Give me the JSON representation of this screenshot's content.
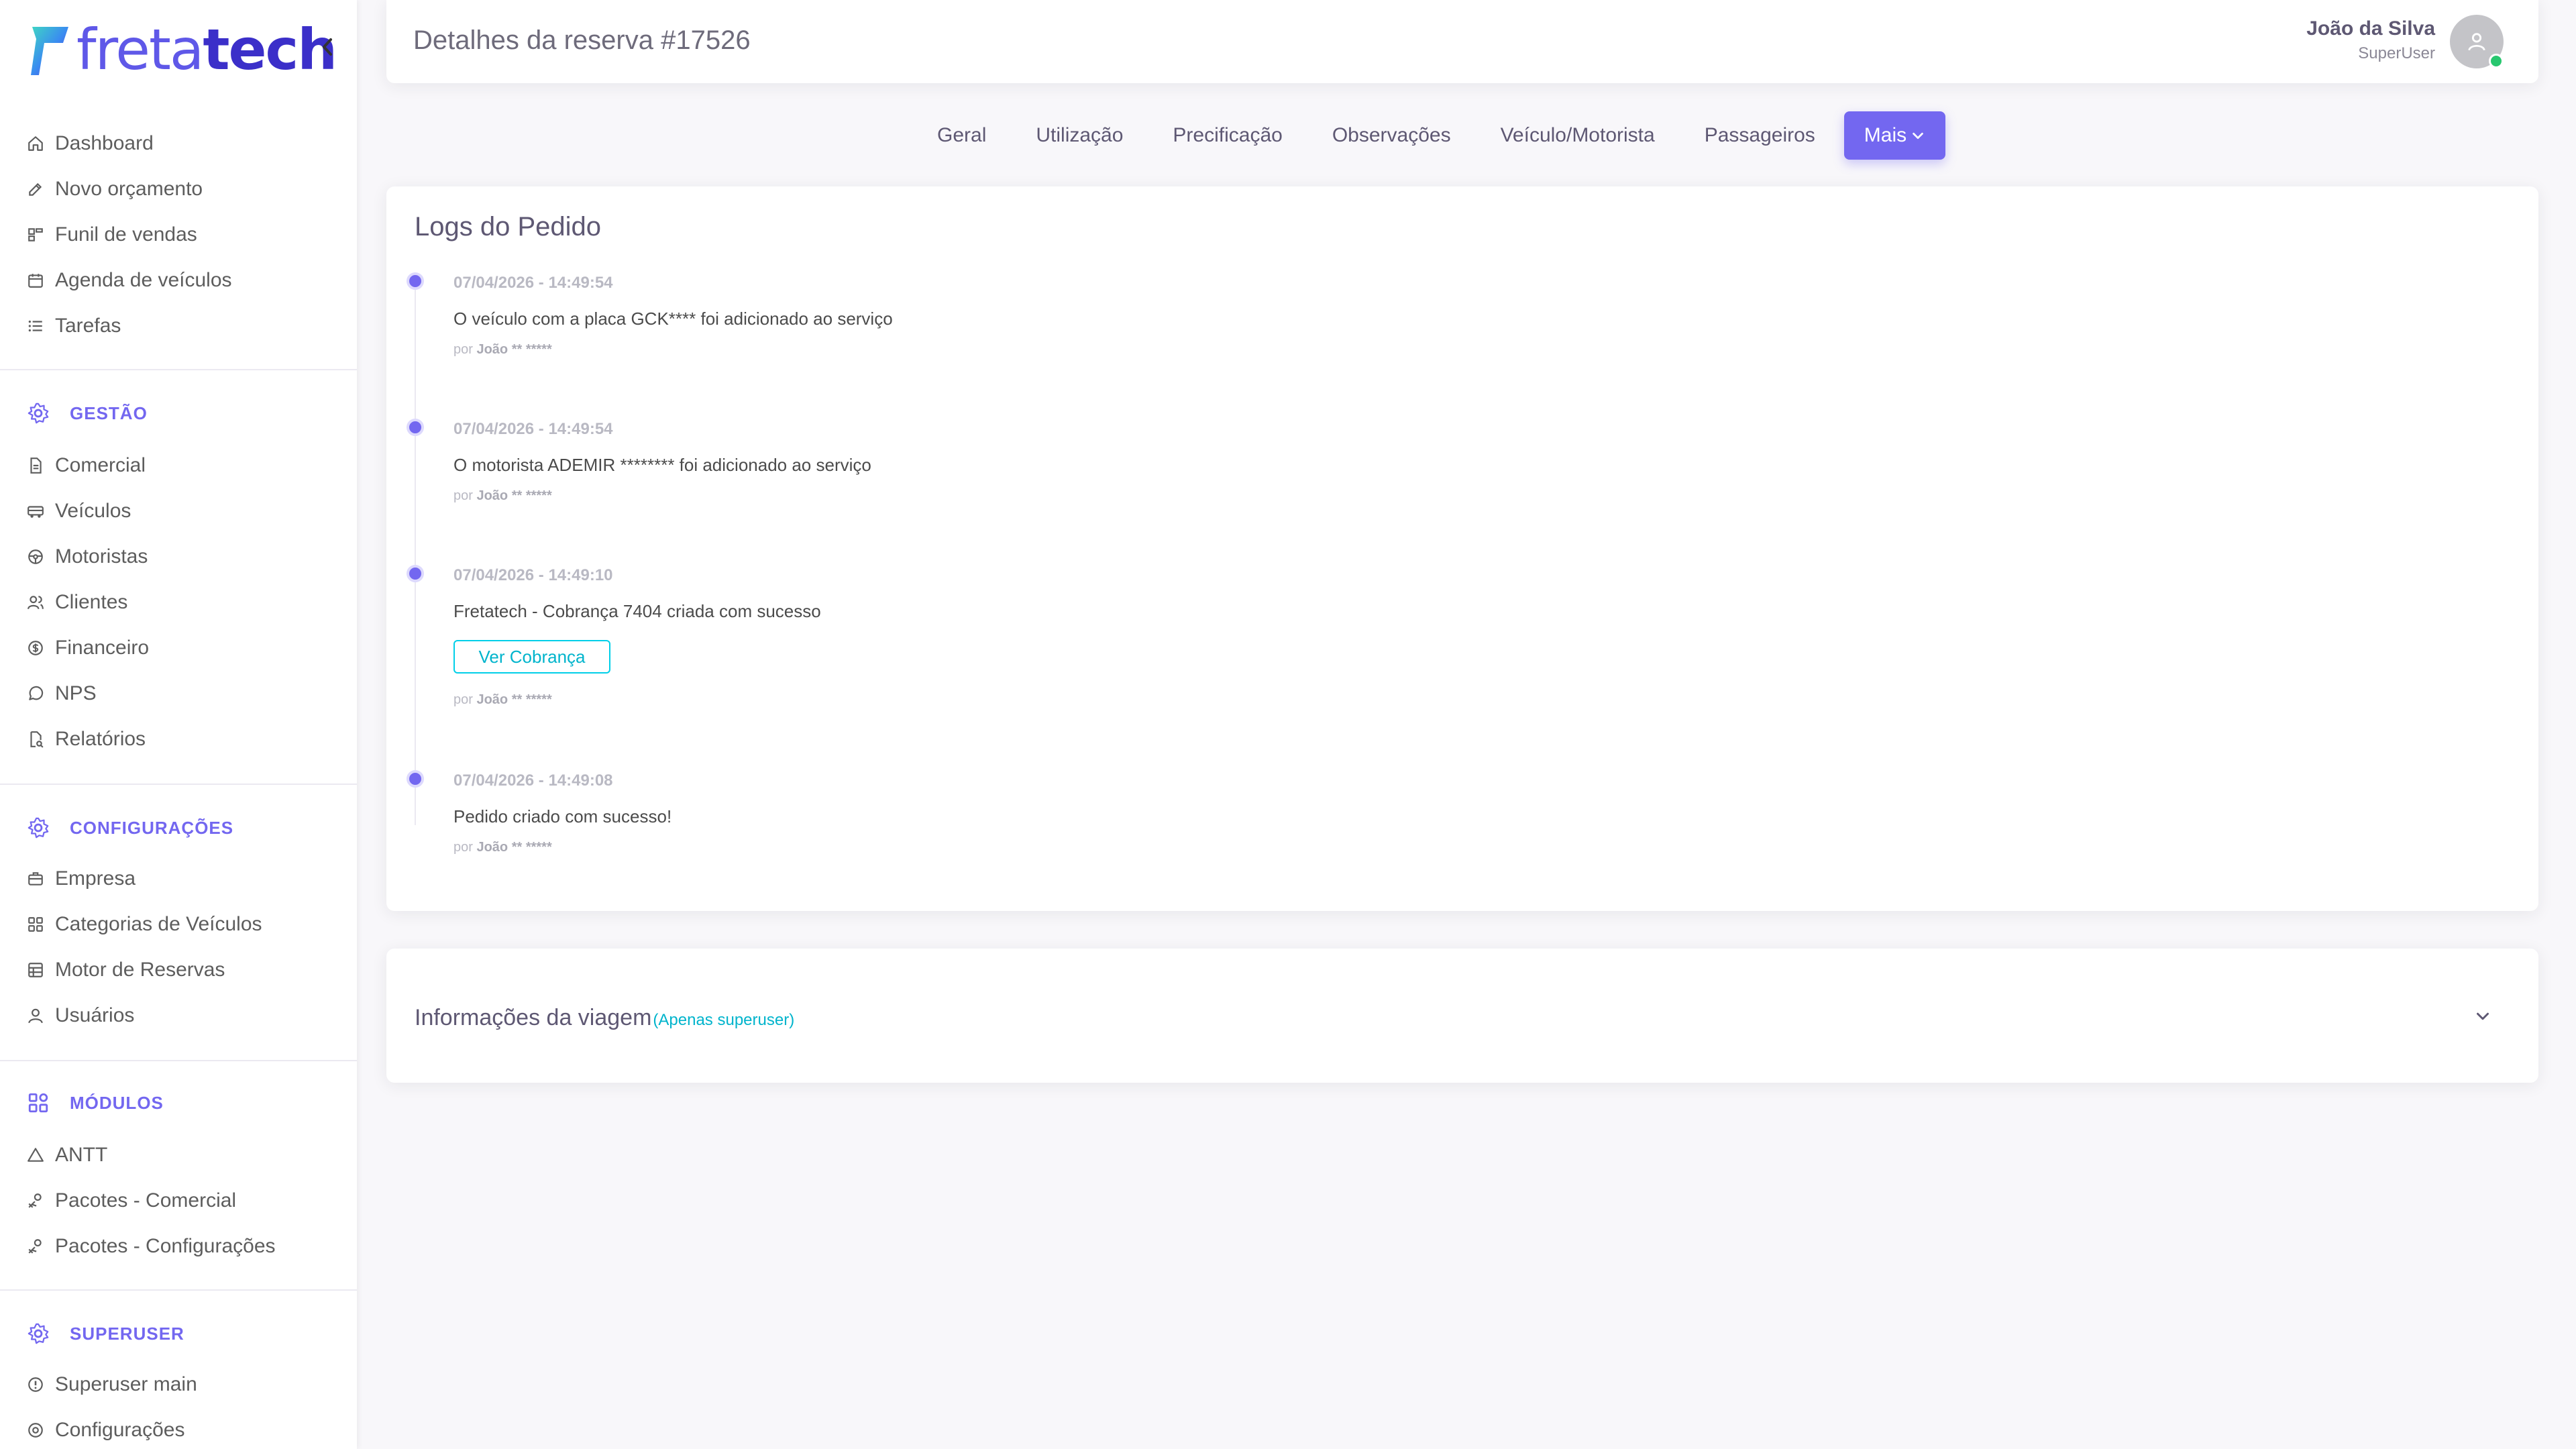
{
  "brand": {
    "name_light": "freta",
    "name_bold": "tech",
    "primary_color": "#7367f0"
  },
  "sidebar": {
    "main_items": [
      {
        "label": "Dashboard",
        "icon": "home-icon"
      },
      {
        "label": "Novo orçamento",
        "icon": "edit-icon"
      },
      {
        "label": "Funil de vendas",
        "icon": "funnel-icon"
      },
      {
        "label": "Agenda de veículos",
        "icon": "calendar-icon"
      },
      {
        "label": "Tarefas",
        "icon": "list-icon"
      }
    ],
    "sections": [
      {
        "title": "GESTÃO",
        "icon": "gear-icon",
        "items": [
          {
            "label": "Comercial",
            "icon": "document-icon"
          },
          {
            "label": "Veículos",
            "icon": "truck-icon"
          },
          {
            "label": "Motoristas",
            "icon": "steering-wheel-icon"
          },
          {
            "label": "Clientes",
            "icon": "users-icon"
          },
          {
            "label": "Financeiro",
            "icon": "dollar-icon"
          },
          {
            "label": "NPS",
            "icon": "message-icon"
          },
          {
            "label": "Relatórios",
            "icon": "report-icon"
          }
        ]
      },
      {
        "title": "CONFIGURAÇÕES",
        "icon": "gear-icon",
        "items": [
          {
            "label": "Empresa",
            "icon": "briefcase-icon"
          },
          {
            "label": "Categorias de Veículos",
            "icon": "grid-icon"
          },
          {
            "label": "Motor de Reservas",
            "icon": "table-icon"
          },
          {
            "label": "Usuários",
            "icon": "user-icon"
          }
        ]
      },
      {
        "title": "MÓDULOS",
        "icon": "modules-icon",
        "items": [
          {
            "label": "ANTT",
            "icon": "triangle-icon"
          },
          {
            "label": "Pacotes - Comercial",
            "icon": "package-icon"
          },
          {
            "label": "Pacotes - Configurações",
            "icon": "package-icon"
          }
        ]
      },
      {
        "title": "SUPERUSER",
        "icon": "gear-icon",
        "items": [
          {
            "label": "Superuser main",
            "icon": "info-icon"
          },
          {
            "label": "Configurações",
            "icon": "settings-icon"
          }
        ]
      }
    ]
  },
  "header": {
    "title": "Detalhes da reserva #17526",
    "user_name": "João da Silva",
    "user_role": "SuperUser"
  },
  "tabs": [
    {
      "label": "Geral"
    },
    {
      "label": "Utilização"
    },
    {
      "label": "Precificação"
    },
    {
      "label": "Observações"
    },
    {
      "label": "Veículo/Motorista"
    },
    {
      "label": "Passageiros"
    },
    {
      "label": "Mais"
    }
  ],
  "logs": {
    "title": "Logs do Pedido",
    "by_prefix": "por",
    "entries": [
      {
        "time": "07/04/2026 - 14:49:54",
        "text": "O veículo com a placa GCK**** foi adicionado ao serviço",
        "author": "João ** *****"
      },
      {
        "time": "07/04/2026 - 14:49:54",
        "text": "O motorista ADEMIR ******** foi adicionado ao serviço",
        "author": "João ** *****"
      },
      {
        "time": "07/04/2026 - 14:49:10",
        "text": "Fretatech - Cobrança 7404 criada com sucesso",
        "author": "João ** *****",
        "button": "Ver Cobrança"
      },
      {
        "time": "07/04/2026 - 14:49:08",
        "text": "Pedido criado com sucesso!",
        "author": "João ** *****"
      }
    ]
  },
  "trip_info": {
    "title": "Informações da viagem",
    "note": "(Apenas superuser)"
  }
}
